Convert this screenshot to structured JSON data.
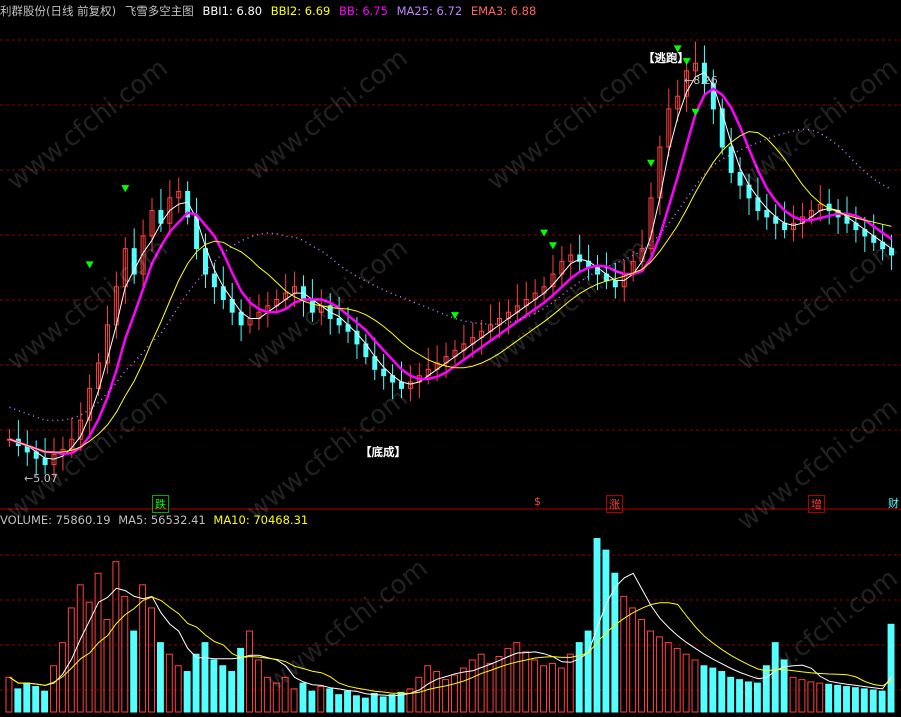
{
  "header": {
    "stock_title": "利群股份(日线 前复权)",
    "indicator_name": "飞雪多空主图",
    "bbi1": "BBI1: 6.80",
    "bbi2": "BBI2: 6.69",
    "bb": "BB: 6.75",
    "ma25": "MA25: 6.72",
    "ema3": "EMA3: 6.88"
  },
  "volume_header": {
    "volume": "VOLUME: 75860.19",
    "ma5": "MA5: 56532.41",
    "ma10": "MA10: 70468.31"
  },
  "annotations": {
    "high_price": "8.26",
    "low_price": "5.07",
    "bottom_tag": "【底成】",
    "top_tag": "【逃跑】"
  },
  "event_markers": [
    {
      "label": "跌",
      "type": "down"
    },
    {
      "label": "$",
      "type": "up"
    },
    {
      "label": "涨",
      "type": "up"
    },
    {
      "label": "增",
      "type": "up"
    },
    {
      "label": "财",
      "type": "info"
    }
  ],
  "watermark": "www.cfchi.com",
  "colors": {
    "bbi1": "#ffffff",
    "bbi2": "#ffff00",
    "bb": "#ff00ff",
    "ma25": "#c080ff",
    "ema3": "#ff6060",
    "up_candle": "#ff4040",
    "down_candle": "#54ffff",
    "grid": "#8b0000",
    "signal": "#00ff00"
  },
  "chart_data": {
    "type": "candlestick",
    "price_range": [
      4.9,
      8.6
    ],
    "closes": [
      5.3,
      5.25,
      5.2,
      5.15,
      5.1,
      5.18,
      5.22,
      5.3,
      5.45,
      5.7,
      5.9,
      6.2,
      6.5,
      6.8,
      6.6,
      6.9,
      7.1,
      7.0,
      7.2,
      7.25,
      7.05,
      6.8,
      6.6,
      6.5,
      6.4,
      6.3,
      6.2,
      6.25,
      6.3,
      6.35,
      6.4,
      6.45,
      6.5,
      6.4,
      6.3,
      6.35,
      6.25,
      6.2,
      6.15,
      6.05,
      5.95,
      5.85,
      5.8,
      5.75,
      5.7,
      5.75,
      5.8,
      5.85,
      5.9,
      5.95,
      6.0,
      6.05,
      6.1,
      6.15,
      6.2,
      6.25,
      6.3,
      6.35,
      6.4,
      6.45,
      6.5,
      6.6,
      6.7,
      6.75,
      6.7,
      6.65,
      6.6,
      6.55,
      6.5,
      6.6,
      6.7,
      6.8,
      7.2,
      7.6,
      7.9,
      8.0,
      8.2,
      8.26,
      8.1,
      7.9,
      7.6,
      7.4,
      7.3,
      7.2,
      7.1,
      7.05,
      7.0,
      6.95,
      7.0,
      7.05,
      7.1,
      7.15,
      7.1,
      7.05,
      7.0,
      6.95,
      6.9,
      6.85,
      6.8,
      6.75
    ],
    "volume_range": [
      0,
      160000
    ],
    "volumes": [
      30000,
      20000,
      25000,
      22000,
      18000,
      40000,
      60000,
      90000,
      110000,
      95000,
      120000,
      80000,
      130000,
      100000,
      70000,
      110000,
      90000,
      60000,
      50000,
      40000,
      35000,
      50000,
      60000,
      45000,
      40000,
      35000,
      55000,
      70000,
      45000,
      30000,
      25000,
      30000,
      20000,
      25000,
      18000,
      22000,
      20000,
      15000,
      18000,
      14000,
      12000,
      16000,
      13000,
      15000,
      17000,
      20000,
      30000,
      40000,
      35000,
      28000,
      32000,
      38000,
      45000,
      50000,
      42000,
      48000,
      55000,
      60000,
      52000,
      45000,
      40000,
      42000,
      38000,
      50000,
      60000,
      70000,
      150000,
      140000,
      120000,
      100000,
      90000,
      80000,
      70000,
      65000,
      60000,
      55000,
      50000,
      45000,
      40000,
      38000,
      35000,
      30000,
      28000,
      26000,
      25000,
      40000,
      60000,
      45000,
      30000,
      28000,
      26000,
      25000,
      24000,
      23000,
      22000,
      21000,
      20000,
      19000,
      18000,
      75860
    ]
  }
}
